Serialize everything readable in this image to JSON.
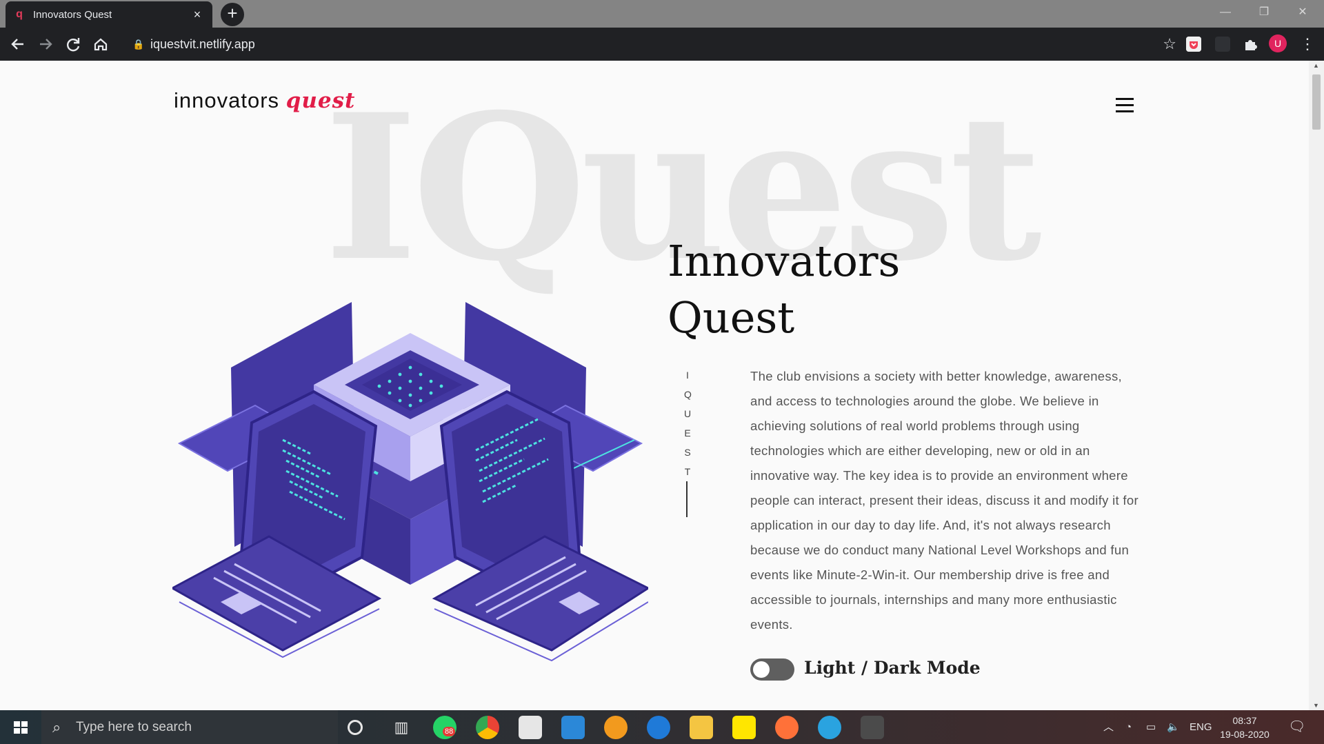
{
  "browser": {
    "tab_title": "Innovators Quest",
    "tab_favicon": "q",
    "tab_close": "×",
    "new_tab": "+",
    "url": "iquestvit.netlify.app",
    "window_controls": {
      "minimize": "—",
      "restore": "❐",
      "close": "✕"
    },
    "nav_icons": [
      "back-icon",
      "forward-icon",
      "reload-icon",
      "home-icon"
    ],
    "avatar_initial": "U"
  },
  "site": {
    "logo_text": "innovators",
    "logo_accent": "quest",
    "watermark": "IQuest",
    "heading_line1": "Innovators",
    "heading_line2": "Quest",
    "vertical_label": "IQUEST",
    "description": "The club envisions a society with better knowledge, awareness, and access to technologies around the globe. We believe in achieving solutions of real world problems through using technologies which are either developing, new or old in an innovative way. The key idea is to provide an environment where people can interact, present their ideas, discuss it and modify it for application in our day to day life. And, it's not always research because we do conduct many National Level Workshops and fun events like Minute-2-Win-it. Our membership drive is free and accessible to journals, internships and many more enthusiastic events.",
    "toggle_label": "Light / Dark Mode",
    "accent_color": "#e11d48",
    "illustration_color": "#4b3fa8"
  },
  "taskbar": {
    "search_placeholder": "Type here to search",
    "whatsapp_badge": "88",
    "language": "ENG",
    "time": "08:37",
    "date": "19-08-2020"
  }
}
